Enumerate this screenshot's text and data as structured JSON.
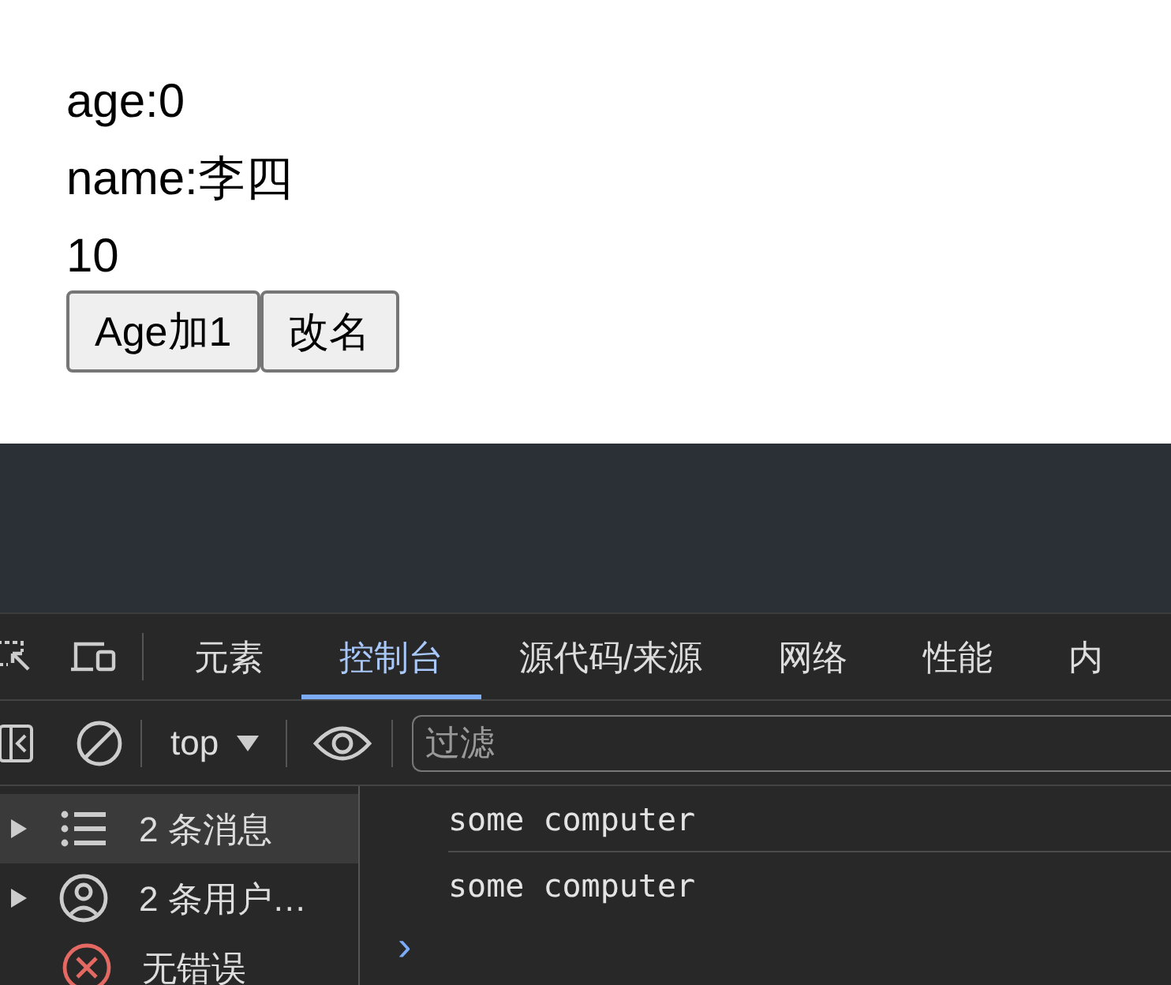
{
  "page": {
    "lines": [
      "age:0",
      "name:李四",
      "10"
    ],
    "buttons": [
      "Age加1",
      "改名"
    ]
  },
  "devtools": {
    "tabs": [
      {
        "label": "元素",
        "selected": false
      },
      {
        "label": "控制台",
        "selected": true
      },
      {
        "label": "源代码/来源",
        "selected": false
      },
      {
        "label": "网络",
        "selected": false
      },
      {
        "label": "性能",
        "selected": false
      },
      {
        "label": "内",
        "selected": false
      }
    ],
    "context": "top",
    "filter": {
      "placeholder": "过滤"
    },
    "sidebar": [
      {
        "kind": "messages",
        "label": "2 条消息",
        "selected": true
      },
      {
        "kind": "user",
        "label": "2 条用户…",
        "selected": false
      },
      {
        "kind": "error",
        "label": "无错误",
        "selected": false
      }
    ],
    "console": [
      "some computer",
      "some computer"
    ],
    "prompt": "›"
  }
}
